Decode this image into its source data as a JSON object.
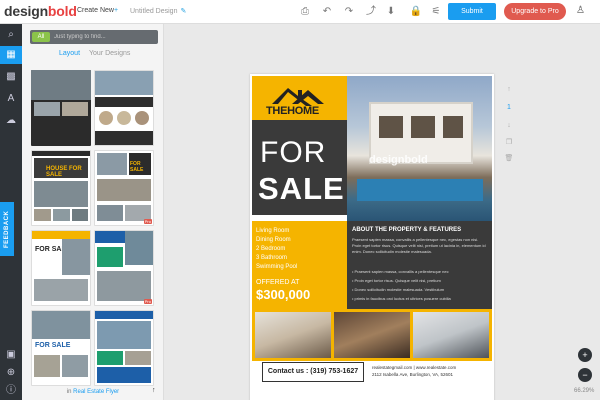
{
  "app": {
    "logo_main": "design",
    "logo_accent": "bold",
    "create_new": "Create New",
    "create_new_badge": "+",
    "doc_title": "Untitled Design",
    "submit": "Submit",
    "upgrade": "Upgrade to Pro"
  },
  "rail": {
    "feedback": "FEEDBACK"
  },
  "panel": {
    "filter": "All",
    "search_placeholder": "Just typing to find...",
    "tabs": [
      "Layout",
      "Your Designs"
    ],
    "footer_prefix": "in",
    "footer_link": "Real Estate Flyer",
    "thumb_labels": {
      "for_sale_1": "FOR SALE",
      "for_sale_2": "FOR SALE",
      "for_sale_3": "FOR SALE",
      "house_for_sale": "HOUSE FOR SALE",
      "pro": "Pro"
    }
  },
  "flyer": {
    "brand": "THEHOME",
    "headline_top": "FOR",
    "headline_bottom": "SALE",
    "watermark": "designbold",
    "features": [
      "Living Room",
      "Dining Room",
      "2 Bedroom",
      "3 Bathroom",
      "Swimming Pool"
    ],
    "offered_label": "OFFERED AT",
    "price": "$300,000",
    "about_title": "ABOUT THE PROPERTY & FEATURES",
    "about_text": "Praesent sapien massa, convallis a pellentesque nec, egestas non nisi. Proin eget tortor risus. Quisque velit nisi, pretium ut lacinia in, elementum id enim. Donec sollicitudin molestie malesuada.",
    "bullets": [
      "Praesent sapien massa, convallis a pellentesque nec",
      "Proin eget tortor risus. Quisque velit nisi, pretium",
      "Donec sollicitudin molestie malesuada. Vestibulum",
      "primis in faucibus orci luctus et ultrices posuere cubilia"
    ],
    "contact": "Contact us : (319) 753-1627",
    "contact_web": "realestategmail.com | www.realestate.com",
    "contact_address": "2112 Isabella Ave, Burlington, VA, 52601"
  },
  "canvas": {
    "page_number": "1",
    "zoom": "66.29%"
  },
  "colors": {
    "accent": "#1a9df0",
    "upgrade": "#e05a4f",
    "flyer_yellow": "#f5b400",
    "flyer_dark": "#3a3a3a"
  }
}
